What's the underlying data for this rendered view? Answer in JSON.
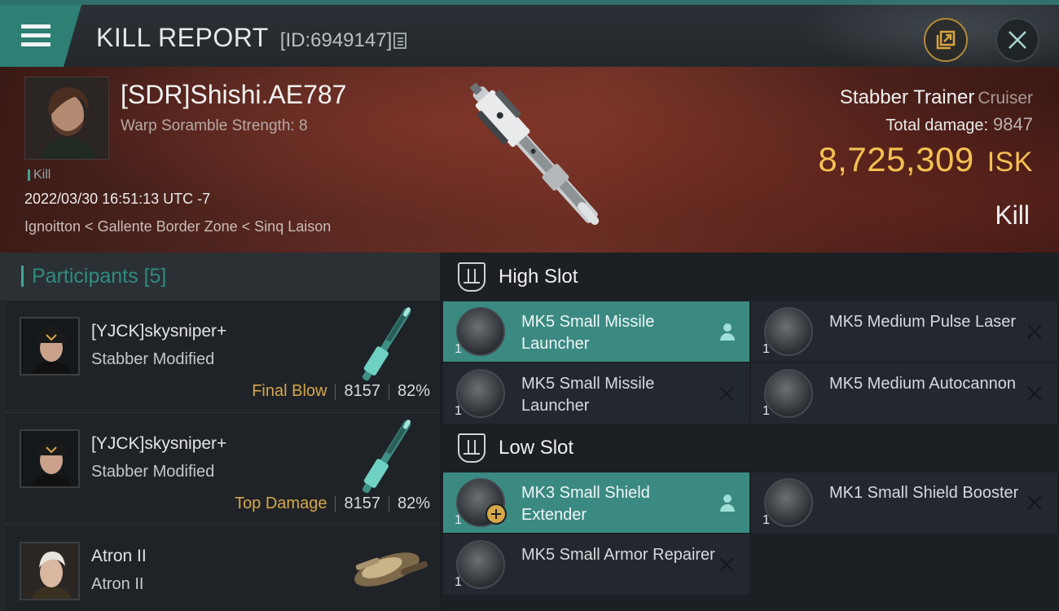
{
  "header": {
    "title": "KILL REPORT",
    "report_id": "[ID:6949147]"
  },
  "victim": {
    "name": "[SDR]Shishi.AE787",
    "scramble": "Warp Soramble Strength: 8",
    "kill_tag": "Kill",
    "datetime": "2022/03/30 16:51:13 UTC -7",
    "location": "Ignoitton < Gallente Border Zone < Sinq Laison",
    "ship_name": "Stabber Trainer",
    "ship_class": "Cruiser",
    "total_damage_label": "Total damage:",
    "total_damage": "9847",
    "isk_value": "8,725,309",
    "isk_unit": "ISK",
    "result": "Kill"
  },
  "participants": {
    "label": "Participants",
    "count": "[5]",
    "items": [
      {
        "name": "[YJCK]skysniper+",
        "ship": "Stabber Modified",
        "tag": "Final Blow",
        "damage": "8157",
        "percent": "82%"
      },
      {
        "name": "[YJCK]skysniper+",
        "ship": "Stabber Modified",
        "tag": "Top Damage",
        "damage": "8157",
        "percent": "82%"
      },
      {
        "name": "Atron II",
        "ship": "Atron II",
        "tag": "",
        "damage": "",
        "percent": ""
      }
    ]
  },
  "fitting": {
    "high_slot": {
      "label": "High Slot",
      "modules": [
        {
          "name": "MK5 Small Missile Launcher",
          "qty": "1",
          "action": "person-icon",
          "highlighted": true
        },
        {
          "name": "MK5 Medium Pulse Laser",
          "qty": "1",
          "action": "close-icon",
          "highlighted": false
        },
        {
          "name": "MK5 Small Missile Launcher",
          "qty": "1",
          "action": "close-icon",
          "highlighted": false
        },
        {
          "name": "MK5 Medium Autocannon",
          "qty": "1",
          "action": "close-icon",
          "highlighted": false
        }
      ]
    },
    "low_slot": {
      "label": "Low Slot",
      "modules": [
        {
          "name": "MK3 Small Shield Extender",
          "qty": "1",
          "action": "person-icon",
          "highlighted": true
        },
        {
          "name": "MK1 Small Shield Booster",
          "qty": "1",
          "action": "close-icon",
          "highlighted": false
        },
        {
          "name": "MK5 Small Armor Repairer",
          "qty": "1",
          "action": "close-icon",
          "highlighted": false
        }
      ]
    }
  },
  "colors": {
    "accent_teal": "#3a8a82",
    "isk_gold": "#f4c052",
    "tag_gold": "#d6a74a"
  }
}
